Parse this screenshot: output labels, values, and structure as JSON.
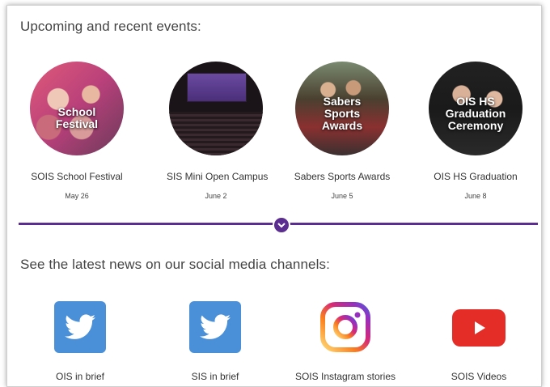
{
  "section1": {
    "heading": "Upcoming and recent events:"
  },
  "events": [
    {
      "title": "SOIS School Festival",
      "date": "May 26",
      "overlay": [
        "School",
        "Festival"
      ]
    },
    {
      "title": "SIS Mini Open Campus",
      "date": "June 2",
      "overlay": []
    },
    {
      "title": "Sabers Sports Awards",
      "date": "June 5",
      "overlay": [
        "Sabers",
        "Sports",
        "Awards"
      ]
    },
    {
      "title": "OIS HS Graduation",
      "date": "June 8",
      "overlay": [
        "OIS HS",
        "Graduation",
        "Ceremony"
      ]
    }
  ],
  "section2": {
    "heading": "See the latest news on our social media channels:"
  },
  "social": [
    {
      "label": "OIS in brief",
      "icon": "twitter-icon",
      "color": "#4a90d9"
    },
    {
      "label": "SIS in brief",
      "icon": "twitter-icon",
      "color": "#4a90d9"
    },
    {
      "label": "SOIS Instagram stories",
      "icon": "instagram-icon",
      "color": "#c13584"
    },
    {
      "label": "SOIS Videos",
      "icon": "youtube-icon",
      "color": "#e52d27"
    }
  ],
  "colors": {
    "accent": "#5c2d91"
  }
}
